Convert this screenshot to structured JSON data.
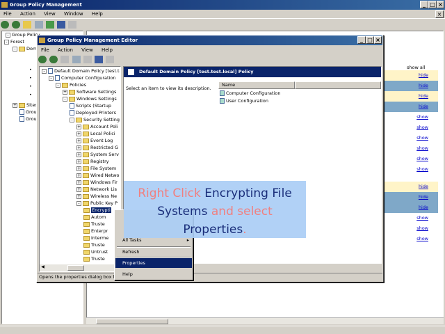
{
  "background_window": {
    "title": "Group Policy Management",
    "menu": [
      "File",
      "Action",
      "View",
      "Window",
      "Help"
    ],
    "tree": [
      "Group Policy",
      "Forest",
      "Dom",
      "Sites",
      "Group",
      "Group"
    ],
    "right_header": "show all",
    "show_links": [
      "hide",
      "hide",
      "hide",
      "hide",
      "show",
      "show",
      "show",
      "show",
      "show",
      "show",
      "hide",
      "hide",
      "hide",
      "show",
      "show",
      "show"
    ]
  },
  "editor": {
    "title": "Group Policy Management Editor",
    "menu": [
      "File",
      "Action",
      "View",
      "Help"
    ],
    "tree": [
      "Default Domain Policy [test.test]",
      "Computer Configuration",
      "Policies",
      "Software Settings",
      "Windows Settings",
      "Scripts (Startup",
      "Deployed Printers",
      "Security Settings",
      "Account Poli",
      "Local Polici",
      "Event Log",
      "Restricted G",
      "System Serv",
      "Registry",
      "File System",
      "Wired Netwo",
      "Windows Fir",
      "Network Lis",
      "Wireless Ne",
      "Public Key P",
      "Encrypti",
      "Autom",
      "Truste",
      "Enterpr",
      "Interme",
      "Truste",
      "Untrust",
      "Truste"
    ],
    "header_title": "Default Domain Policy [test.test.local] Policy",
    "select_hint": "Select an item to view its description.",
    "column_name": "Name",
    "items": [
      "Computer Configuration",
      "User Configuration"
    ],
    "status": "Opens the properties dialog box for"
  },
  "context_menu": {
    "items": [
      "All Tasks",
      "Refresh",
      "Properties",
      "Help"
    ],
    "selected": "Properties"
  },
  "callout": {
    "part1": "Right Click ",
    "part2": "Encrypting File Systems",
    "part3": " and select ",
    "part4": "Properties",
    "part5": "."
  }
}
